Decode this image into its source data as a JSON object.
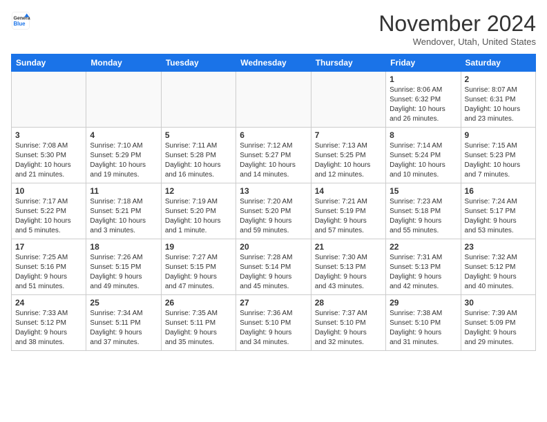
{
  "header": {
    "logo_line1": "General",
    "logo_line2": "Blue",
    "month_title": "November 2024",
    "location": "Wendover, Utah, United States"
  },
  "weekdays": [
    "Sunday",
    "Monday",
    "Tuesday",
    "Wednesday",
    "Thursday",
    "Friday",
    "Saturday"
  ],
  "weeks": [
    [
      {
        "day": "",
        "info": ""
      },
      {
        "day": "",
        "info": ""
      },
      {
        "day": "",
        "info": ""
      },
      {
        "day": "",
        "info": ""
      },
      {
        "day": "",
        "info": ""
      },
      {
        "day": "1",
        "info": "Sunrise: 8:06 AM\nSunset: 6:32 PM\nDaylight: 10 hours\nand 26 minutes."
      },
      {
        "day": "2",
        "info": "Sunrise: 8:07 AM\nSunset: 6:31 PM\nDaylight: 10 hours\nand 23 minutes."
      }
    ],
    [
      {
        "day": "3",
        "info": "Sunrise: 7:08 AM\nSunset: 5:30 PM\nDaylight: 10 hours\nand 21 minutes."
      },
      {
        "day": "4",
        "info": "Sunrise: 7:10 AM\nSunset: 5:29 PM\nDaylight: 10 hours\nand 19 minutes."
      },
      {
        "day": "5",
        "info": "Sunrise: 7:11 AM\nSunset: 5:28 PM\nDaylight: 10 hours\nand 16 minutes."
      },
      {
        "day": "6",
        "info": "Sunrise: 7:12 AM\nSunset: 5:27 PM\nDaylight: 10 hours\nand 14 minutes."
      },
      {
        "day": "7",
        "info": "Sunrise: 7:13 AM\nSunset: 5:25 PM\nDaylight: 10 hours\nand 12 minutes."
      },
      {
        "day": "8",
        "info": "Sunrise: 7:14 AM\nSunset: 5:24 PM\nDaylight: 10 hours\nand 10 minutes."
      },
      {
        "day": "9",
        "info": "Sunrise: 7:15 AM\nSunset: 5:23 PM\nDaylight: 10 hours\nand 7 minutes."
      }
    ],
    [
      {
        "day": "10",
        "info": "Sunrise: 7:17 AM\nSunset: 5:22 PM\nDaylight: 10 hours\nand 5 minutes."
      },
      {
        "day": "11",
        "info": "Sunrise: 7:18 AM\nSunset: 5:21 PM\nDaylight: 10 hours\nand 3 minutes."
      },
      {
        "day": "12",
        "info": "Sunrise: 7:19 AM\nSunset: 5:20 PM\nDaylight: 10 hours\nand 1 minute."
      },
      {
        "day": "13",
        "info": "Sunrise: 7:20 AM\nSunset: 5:20 PM\nDaylight: 9 hours\nand 59 minutes."
      },
      {
        "day": "14",
        "info": "Sunrise: 7:21 AM\nSunset: 5:19 PM\nDaylight: 9 hours\nand 57 minutes."
      },
      {
        "day": "15",
        "info": "Sunrise: 7:23 AM\nSunset: 5:18 PM\nDaylight: 9 hours\nand 55 minutes."
      },
      {
        "day": "16",
        "info": "Sunrise: 7:24 AM\nSunset: 5:17 PM\nDaylight: 9 hours\nand 53 minutes."
      }
    ],
    [
      {
        "day": "17",
        "info": "Sunrise: 7:25 AM\nSunset: 5:16 PM\nDaylight: 9 hours\nand 51 minutes."
      },
      {
        "day": "18",
        "info": "Sunrise: 7:26 AM\nSunset: 5:15 PM\nDaylight: 9 hours\nand 49 minutes."
      },
      {
        "day": "19",
        "info": "Sunrise: 7:27 AM\nSunset: 5:15 PM\nDaylight: 9 hours\nand 47 minutes."
      },
      {
        "day": "20",
        "info": "Sunrise: 7:28 AM\nSunset: 5:14 PM\nDaylight: 9 hours\nand 45 minutes."
      },
      {
        "day": "21",
        "info": "Sunrise: 7:30 AM\nSunset: 5:13 PM\nDaylight: 9 hours\nand 43 minutes."
      },
      {
        "day": "22",
        "info": "Sunrise: 7:31 AM\nSunset: 5:13 PM\nDaylight: 9 hours\nand 42 minutes."
      },
      {
        "day": "23",
        "info": "Sunrise: 7:32 AM\nSunset: 5:12 PM\nDaylight: 9 hours\nand 40 minutes."
      }
    ],
    [
      {
        "day": "24",
        "info": "Sunrise: 7:33 AM\nSunset: 5:12 PM\nDaylight: 9 hours\nand 38 minutes."
      },
      {
        "day": "25",
        "info": "Sunrise: 7:34 AM\nSunset: 5:11 PM\nDaylight: 9 hours\nand 37 minutes."
      },
      {
        "day": "26",
        "info": "Sunrise: 7:35 AM\nSunset: 5:11 PM\nDaylight: 9 hours\nand 35 minutes."
      },
      {
        "day": "27",
        "info": "Sunrise: 7:36 AM\nSunset: 5:10 PM\nDaylight: 9 hours\nand 34 minutes."
      },
      {
        "day": "28",
        "info": "Sunrise: 7:37 AM\nSunset: 5:10 PM\nDaylight: 9 hours\nand 32 minutes."
      },
      {
        "day": "29",
        "info": "Sunrise: 7:38 AM\nSunset: 5:10 PM\nDaylight: 9 hours\nand 31 minutes."
      },
      {
        "day": "30",
        "info": "Sunrise: 7:39 AM\nSunset: 5:09 PM\nDaylight: 9 hours\nand 29 minutes."
      }
    ]
  ]
}
